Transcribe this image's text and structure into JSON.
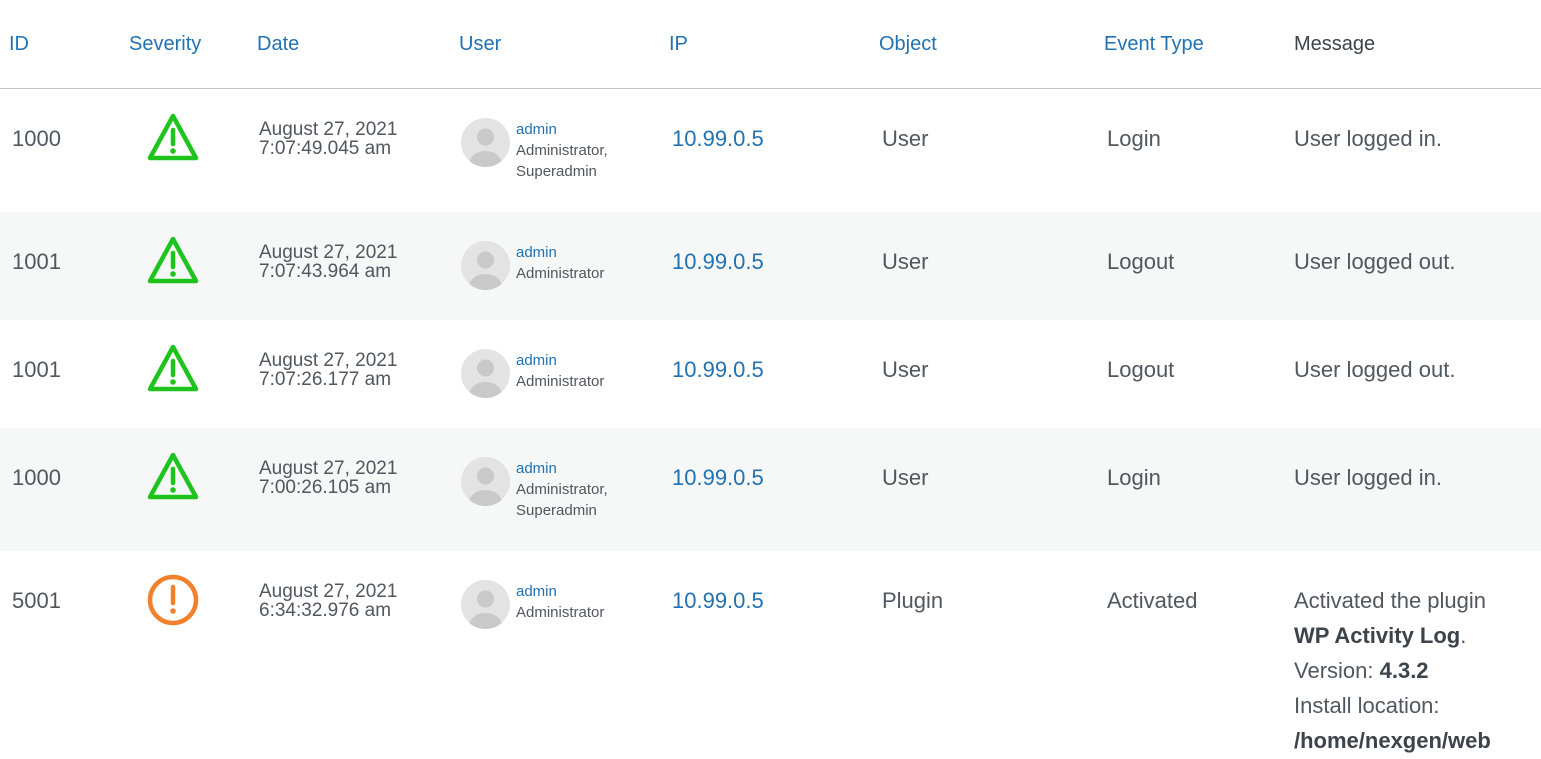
{
  "columns": {
    "id": "ID",
    "severity": "Severity",
    "date": "Date",
    "user": "User",
    "ip": "IP",
    "object": "Object",
    "event_type": "Event Type",
    "message": "Message"
  },
  "colors": {
    "link": "#2271b1",
    "warning_green": "#1ec31e",
    "alert_orange": "#f0802c",
    "alt_row": "#f6f7f7"
  },
  "rows": [
    {
      "id": "1000",
      "severity_icon": "warning-triangle-icon",
      "date": "August 27, 2021",
      "time": "7:07:49.045 am",
      "username": "admin",
      "role": "Administrator,",
      "role2": "Superadmin",
      "ip": "10.99.0.5",
      "object": "User",
      "event_type": "Login",
      "message": "User logged in."
    },
    {
      "id": "1001",
      "severity_icon": "warning-triangle-icon",
      "date": "August 27, 2021",
      "time": "7:07:43.964 am",
      "username": "admin",
      "role": "Administrator",
      "ip": "10.99.0.5",
      "object": "User",
      "event_type": "Logout",
      "message": "User logged out."
    },
    {
      "id": "1001",
      "severity_icon": "warning-triangle-icon",
      "date": "August 27, 2021",
      "time": "7:07:26.177 am",
      "username": "admin",
      "role": "Administrator",
      "ip": "10.99.0.5",
      "object": "User",
      "event_type": "Logout",
      "message": "User logged out."
    },
    {
      "id": "1000",
      "severity_icon": "warning-triangle-icon",
      "date": "August 27, 2021",
      "time": "7:00:26.105 am",
      "username": "admin",
      "role": "Administrator,",
      "role2": "Superadmin",
      "ip": "10.99.0.5",
      "object": "User",
      "event_type": "Login",
      "message": "User logged in."
    },
    {
      "id": "5001",
      "severity_icon": "alert-circle-icon",
      "date": "August 27, 2021",
      "time": "6:34:32.976 am",
      "username": "admin",
      "role": "Administrator",
      "ip": "10.99.0.5",
      "object": "Plugin",
      "event_type": "Activated",
      "message_parts": {
        "intro": "Activated the plugin",
        "plugin_name": "WP Activity Log",
        "period": ".",
        "version_label": "Version: ",
        "version": "4.3.2",
        "location_label": "Install location:",
        "location": "/home/nexgen/web"
      }
    }
  ]
}
